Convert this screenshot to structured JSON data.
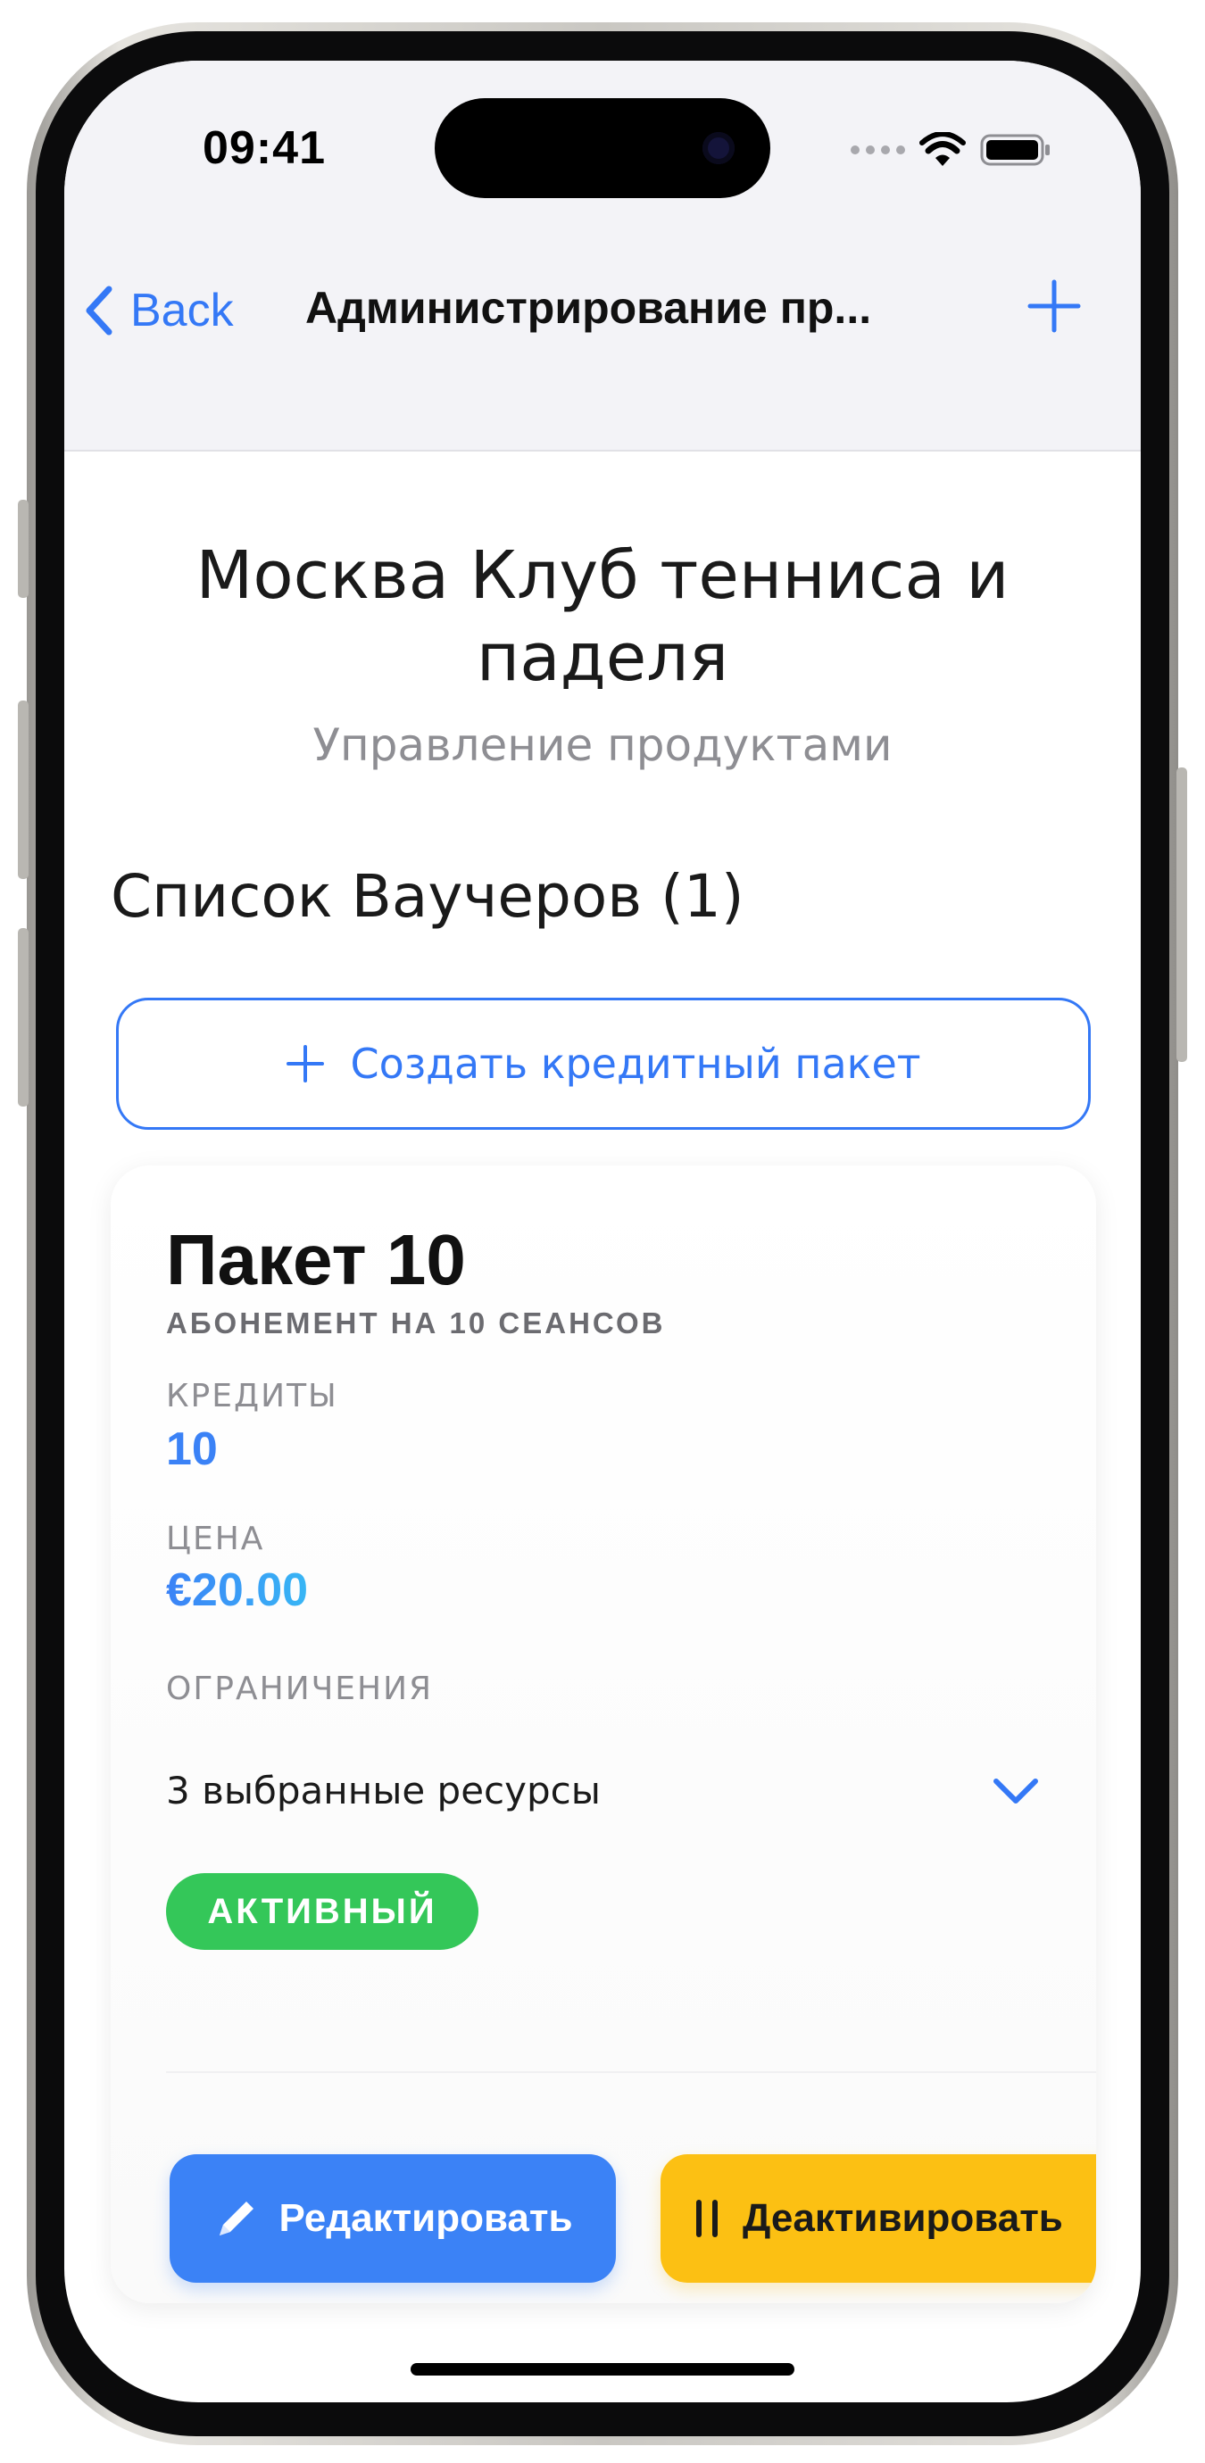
{
  "status_bar": {
    "time": "09:41"
  },
  "nav": {
    "back_label": "Back",
    "title": "Администрирование пр..."
  },
  "club": {
    "title": "Москва Клуб тенниса и паделя",
    "subtitle": "Управление продуктами"
  },
  "vouchers": {
    "section_title": "Список Ваучеров (1)",
    "create_label": "Создать кредитный пакет"
  },
  "card": {
    "title": "Пакет 10",
    "subtitle": "АБОНЕМЕНТ НА 10 СЕАНСОВ",
    "credits_label": "КРЕДИТЫ",
    "credits_value": "10",
    "price_label": "ЦЕНА",
    "price_value": "€20.00",
    "restrictions_label": "ОГРАНИЧЕНИЯ",
    "restrictions_value": "3 выбранные ресурсы",
    "status": "АКТИВНЫЙ",
    "edit_label": "Редактировать",
    "deactivate_label": "Деактивировать"
  },
  "colors": {
    "accent": "#3478f6",
    "active_green": "#34c759",
    "deactivate_yellow": "#fcc013"
  },
  "icons": [
    "chevron-left-icon",
    "plus-icon",
    "chevron-down-icon",
    "pencil-icon",
    "pause-icon",
    "wifi-icon",
    "battery-icon"
  ]
}
